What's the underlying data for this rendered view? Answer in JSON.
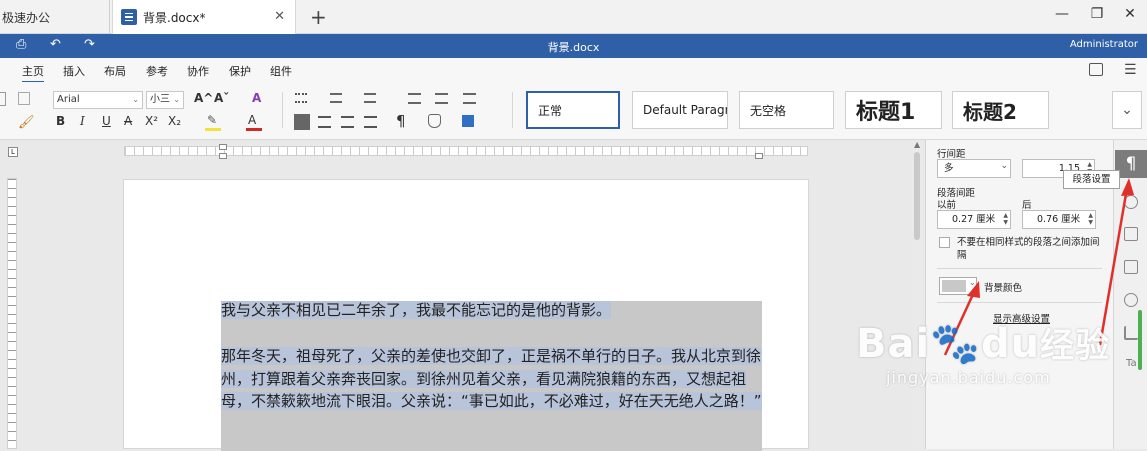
{
  "tabs": {
    "home_label": "极速办公",
    "doc_label": "背景.docx*",
    "close_glyph": "✕",
    "add_glyph": "+"
  },
  "window": {
    "minimize_glyph": "—",
    "restore_glyph": "❐",
    "close_glyph": "✕"
  },
  "titlebar": {
    "doc_title": "背景.docx",
    "user": "Administrator",
    "print_glyph": "⎙",
    "undo_glyph": "↶",
    "redo_glyph": "↷"
  },
  "menu": {
    "items": [
      "主页",
      "插入",
      "布局",
      "参考",
      "协作",
      "保护",
      "组件"
    ]
  },
  "ribbon": {
    "font_name": "Arial",
    "font_size": "小三",
    "grow_glyph": "A^",
    "shrink_glyph": "Aˇ",
    "clear_glyph": "A",
    "bold": "B",
    "italic": "I",
    "underline": "U",
    "strike": "A",
    "superscript": "X²",
    "subscript": "X₂",
    "highlight_glyph": "✎",
    "fontcolor_glyph": "A",
    "para_mark": "¶",
    "styles": [
      "正常",
      "Default Paragraph",
      "无空格",
      "标题1",
      "标题2"
    ],
    "more_glyph": "⌄",
    "highlight_color": "#f3e23a",
    "fontcolor_color": "#d22828"
  },
  "ruler": {
    "corner": "L"
  },
  "document": {
    "paragraphs": [
      "我与父亲不相见已二年余了，我最不能忘记的是他的背影。",
      "那年冬天，祖母死了，父亲的差使也交卸了，正是祸不单行的日子。我从北京到徐州，打算跟着父亲奔丧回家。到徐州见着父亲，看见满院狼籍的东西，又想起祖母，不禁簌簌地流下眼泪。父亲说：“事已如此，不必难过，好在天无绝人之路！”"
    ]
  },
  "panel": {
    "line_spacing_label": "行间距",
    "line_spacing_mode": "多",
    "line_spacing_value": "1.15",
    "para_spacing_label": "段落间距",
    "before_label": "以前",
    "after_label": "后",
    "before_value": "0.27 厘米",
    "after_value": "0.76 厘米",
    "no_space_label": "不要在相同样式的段落之间添加间隔",
    "bg_color_label": "背景颜色",
    "advanced_link": "显示高级设置",
    "swatch_color": "#c8c8c8"
  },
  "tooltip": {
    "text": "段落设置"
  },
  "strip": {
    "para_glyph": "¶"
  },
  "watermark": {
    "brand": "Bai",
    "brand2": "du",
    "brand_cn": "经验",
    "url": "jingyan.baidu.com"
  },
  "accent": "#2f5fa7",
  "arrow_color": "#e0302a"
}
